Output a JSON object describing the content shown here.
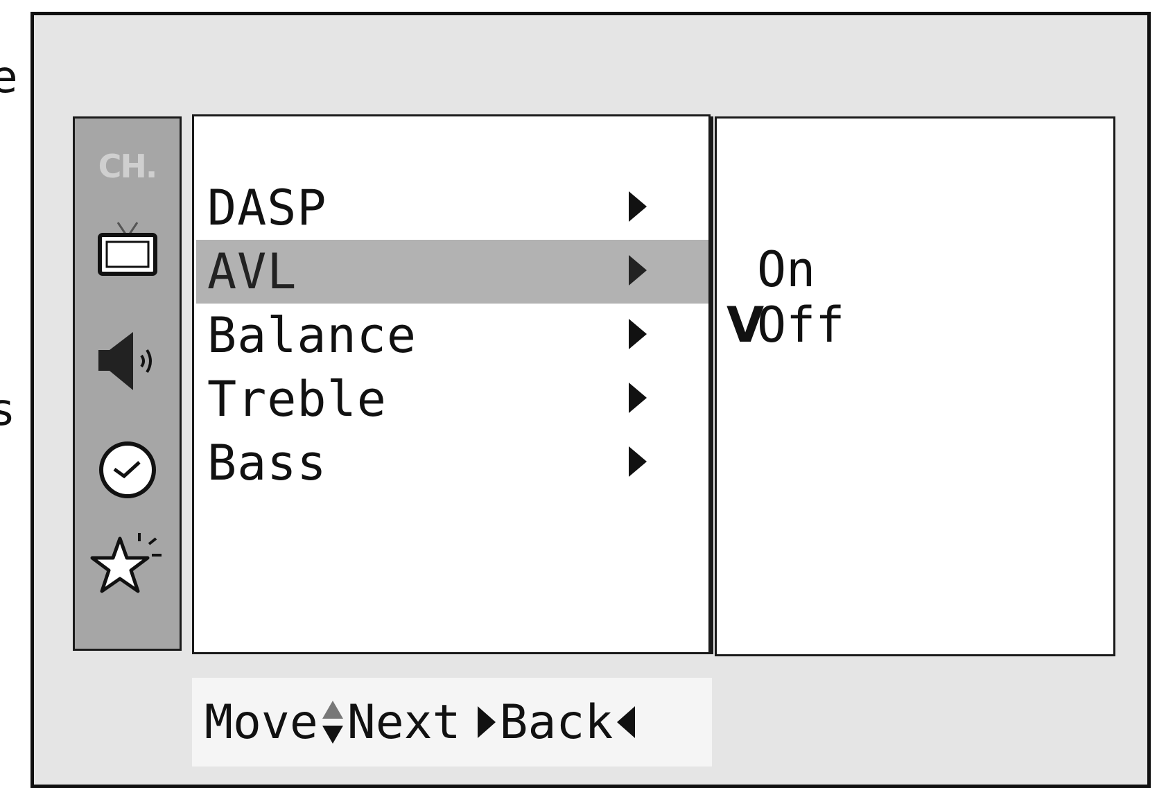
{
  "sidebar": {
    "ch_label": "CH.",
    "icons": [
      "tv-icon",
      "speaker-icon",
      "clock-icon",
      "star-icon"
    ]
  },
  "menu": {
    "items": [
      {
        "label": "DASP",
        "selected": false
      },
      {
        "label": "AVL",
        "selected": true
      },
      {
        "label": "Balance",
        "selected": false
      },
      {
        "label": "Treble",
        "selected": false
      },
      {
        "label": "Bass",
        "selected": false
      }
    ]
  },
  "submenu": {
    "options": [
      {
        "label": "On",
        "checked": false,
        "check": ""
      },
      {
        "label": "Off",
        "checked": true,
        "check": "V"
      }
    ]
  },
  "footer": {
    "move": "Move",
    "next": "Next",
    "back": "Back"
  },
  "colors": {
    "frame": "#e5e5e5",
    "icon_bar": "#a6a6a6",
    "highlight": "#b2b2b2"
  }
}
